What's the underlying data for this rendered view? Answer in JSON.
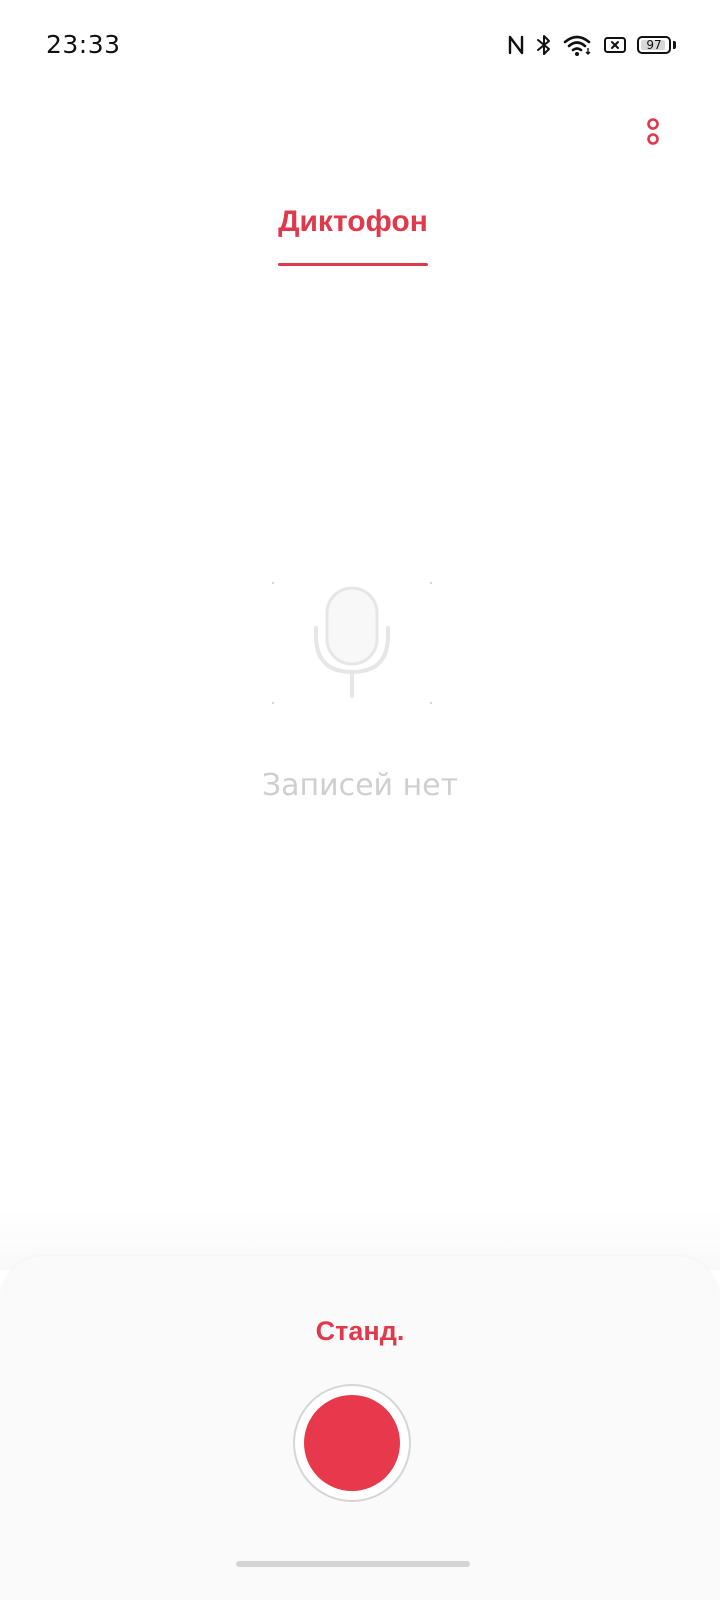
{
  "status_bar": {
    "time": "23:33",
    "battery_level": "97",
    "icons": [
      "nfc-icon",
      "bluetooth-icon",
      "wifi-icon",
      "no-sim-icon",
      "battery-icon"
    ]
  },
  "header": {
    "more_icon": "more-vertical-icon"
  },
  "tabs": [
    {
      "label": "Диктофон",
      "active": true
    }
  ],
  "empty_state": {
    "icon": "microphone-icon",
    "message": "Записей нет"
  },
  "bottom_panel": {
    "mode_label": "Станд.",
    "record_icon": "record-icon"
  },
  "colors": {
    "accent": "#e0394c",
    "record": "#e8394c",
    "empty_text": "#cfcfcf",
    "panel_background": "#fafafa"
  }
}
